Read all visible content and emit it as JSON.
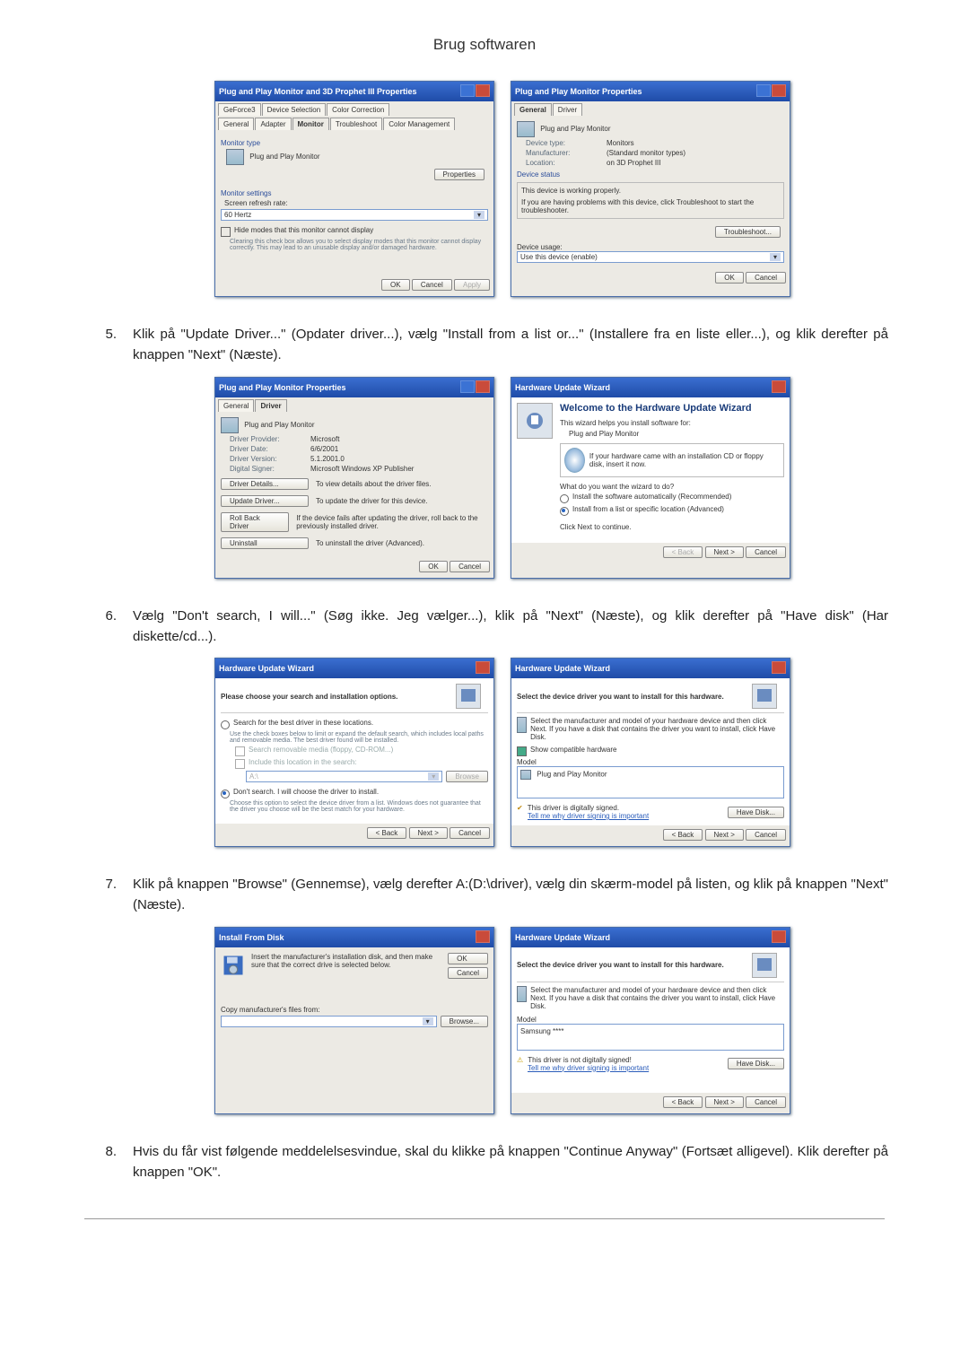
{
  "page_title": "Brug softwaren",
  "steps": {
    "s5": {
      "num": "5.",
      "text": "Klik på \"Update Driver...\" (Opdater driver...), vælg \"Install from a list or...\" (Installere fra en liste eller...), og klik derefter på knappen \"Next\" (Næste)."
    },
    "s6": {
      "num": "6.",
      "text": "Vælg \"Don't search, I will...\" (Søg ikke. Jeg vælger...), klik på \"Next\" (Næste), og klik derefter på \"Have disk\" (Har diskette/cd...)."
    },
    "s7": {
      "num": "7.",
      "text": "Klik på knappen \"Browse\" (Gennemse), vælg derefter A:(D:\\driver), vælg din skærm-model på listen, og klik på knappen \"Next\" (Næste)."
    },
    "s8": {
      "num": "8.",
      "text": "Hvis du får vist følgende meddelelsesvindue, skal du klikke på knappen \"Continue Anyway\" (Fortsæt alligevel). Klik derefter på knappen \"OK\"."
    }
  },
  "dlg1a": {
    "title": "Plug and Play Monitor and 3D Prophet III Properties",
    "tabs": [
      "GeForce3",
      "Device Selection",
      "Color Correction",
      "General",
      "Adapter",
      "Monitor",
      "Troubleshoot",
      "Color Management"
    ],
    "monitor_type_label": "Monitor type",
    "monitor_name": "Plug and Play Monitor",
    "properties_btn": "Properties",
    "settings_label": "Monitor settings",
    "refresh_label": "Screen refresh rate:",
    "refresh_value": "60 Hertz",
    "hide_modes": "Hide modes that this monitor cannot display",
    "hide_modes_desc": "Clearing this check box allows you to select display modes that this monitor cannot display correctly. This may lead to an unusable display and/or damaged hardware.",
    "ok": "OK",
    "cancel": "Cancel",
    "apply": "Apply"
  },
  "dlg1b": {
    "title": "Plug and Play Monitor Properties",
    "tabs": [
      "General",
      "Driver"
    ],
    "device_name": "Plug and Play Monitor",
    "device_type_k": "Device type:",
    "device_type_v": "Monitors",
    "manufacturer_k": "Manufacturer:",
    "manufacturer_v": "(Standard monitor types)",
    "location_k": "Location:",
    "location_v": "on 3D Prophet III",
    "status_label": "Device status",
    "status_line1": "This device is working properly.",
    "status_line2": "If you are having problems with this device, click Troubleshoot to start the troubleshooter.",
    "troubleshoot_btn": "Troubleshoot...",
    "usage_label": "Device usage:",
    "usage_value": "Use this device (enable)",
    "ok": "OK",
    "cancel": "Cancel"
  },
  "dlg2a": {
    "title": "Plug and Play Monitor Properties",
    "tabs": [
      "General",
      "Driver"
    ],
    "device_name": "Plug and Play Monitor",
    "provider_k": "Driver Provider:",
    "provider_v": "Microsoft",
    "date_k": "Driver Date:",
    "date_v": "6/6/2001",
    "version_k": "Driver Version:",
    "version_v": "5.1.2001.0",
    "signer_k": "Digital Signer:",
    "signer_v": "Microsoft Windows XP Publisher",
    "details_btn": "Driver Details...",
    "details_desc": "To view details about the driver files.",
    "update_btn": "Update Driver...",
    "update_desc": "To update the driver for this device.",
    "rollback_btn": "Roll Back Driver",
    "rollback_desc": "If the device fails after updating the driver, roll back to the previously installed driver.",
    "uninstall_btn": "Uninstall",
    "uninstall_desc": "To uninstall the driver (Advanced).",
    "ok": "OK",
    "cancel": "Cancel"
  },
  "dlg2b": {
    "title": "Hardware Update Wizard",
    "welcome": "Welcome to the Hardware Update Wizard",
    "intro": "This wizard helps you install software for:",
    "device": "Plug and Play Monitor",
    "cd_hint": "If your hardware came with an installation CD or floppy disk, insert it now.",
    "prompt": "What do you want the wizard to do?",
    "opt1": "Install the software automatically (Recommended)",
    "opt2": "Install from a list or specific location (Advanced)",
    "cont": "Click Next to continue.",
    "back": "< Back",
    "next": "Next >",
    "cancel": "Cancel"
  },
  "dlg3a": {
    "title": "Hardware Update Wizard",
    "heading": "Please choose your search and installation options.",
    "opt1": "Search for the best driver in these locations.",
    "opt1_desc": "Use the check boxes below to limit or expand the default search, which includes local paths and removable media. The best driver found will be installed.",
    "chk1": "Search removable media (floppy, CD-ROM...)",
    "chk2": "Include this location in the search:",
    "path": "A:\\",
    "browse_btn": "Browse",
    "opt2": "Don't search. I will choose the driver to install.",
    "opt2_desc": "Choose this option to select the device driver from a list. Windows does not guarantee that the driver you choose will be the best match for your hardware.",
    "back": "< Back",
    "next": "Next >",
    "cancel": "Cancel"
  },
  "dlg3b": {
    "title": "Hardware Update Wizard",
    "heading": "Select the device driver you want to install for this hardware.",
    "instr": "Select the manufacturer and model of your hardware device and then click Next. If you have a disk that contains the driver you want to install, click Have Disk.",
    "compat_chk": "Show compatible hardware",
    "model_label": "Model",
    "model_value": "Plug and Play Monitor",
    "signed": "This driver is digitally signed.",
    "tell_me": "Tell me why driver signing is important",
    "have_disk": "Have Disk...",
    "back": "< Back",
    "next": "Next >",
    "cancel": "Cancel"
  },
  "dlg4a": {
    "title": "Install From Disk",
    "instr": "Insert the manufacturer's installation disk, and then make sure that the correct drive is selected below.",
    "ok": "OK",
    "cancel": "Cancel",
    "copy_label": "Copy manufacturer's files from:",
    "path": "",
    "browse_btn": "Browse..."
  },
  "dlg4b": {
    "title": "Hardware Update Wizard",
    "heading": "Select the device driver you want to install for this hardware.",
    "instr": "Select the manufacturer and model of your hardware device and then click Next. If you have a disk that contains the driver you want to install, click Have Disk.",
    "model_label": "Model",
    "model_value": "Samsung ****",
    "not_signed": "This driver is not digitally signed!",
    "tell_me": "Tell me why driver signing is important",
    "have_disk": "Have Disk...",
    "back": "< Back",
    "next": "Next >",
    "cancel": "Cancel"
  }
}
